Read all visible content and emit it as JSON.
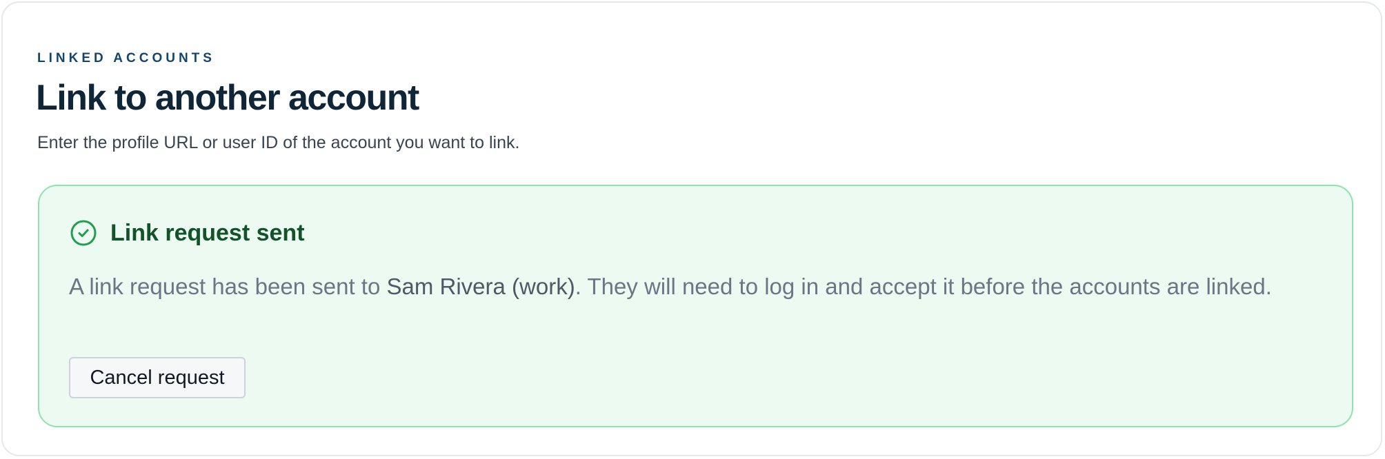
{
  "header": {
    "eyebrow": "LINKED ACCOUNTS",
    "title": "Link to another account",
    "subtitle": "Enter the profile URL or user ID of the account you want to link."
  },
  "alert": {
    "icon": "check-circle-icon",
    "title": "Link request sent",
    "body_prefix": "A link request has been sent to ",
    "account_name": "Sam Rivera (work)",
    "body_suffix": ". They will need to log in and accept it before the accounts are linked.",
    "cancel_label": "Cancel request"
  },
  "colors": {
    "accent_eyebrow": "#12466e",
    "title": "#0f2538",
    "success_bg": "#edfaf1",
    "success_border": "#8ee3aa",
    "success_text": "#13532c",
    "success_icon": "#1f9e4f"
  }
}
